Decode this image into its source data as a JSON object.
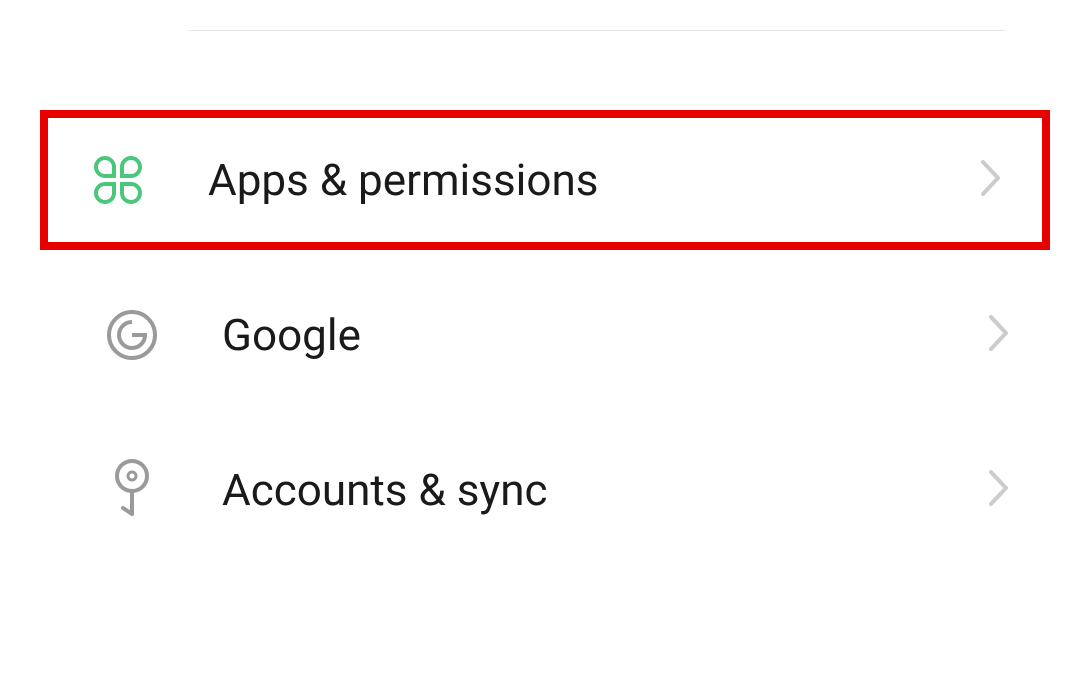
{
  "settings": {
    "items": [
      {
        "label": "Apps & permissions",
        "icon": "clover-icon",
        "highlighted": true
      },
      {
        "label": "Google",
        "icon": "google-icon",
        "highlighted": false
      },
      {
        "label": "Accounts & sync",
        "icon": "key-icon",
        "highlighted": false
      }
    ]
  },
  "colors": {
    "highlight_border": "#e60000",
    "icon_green": "#4ac77a",
    "icon_gray": "#9a9a9a",
    "chevron": "#cccccc"
  }
}
